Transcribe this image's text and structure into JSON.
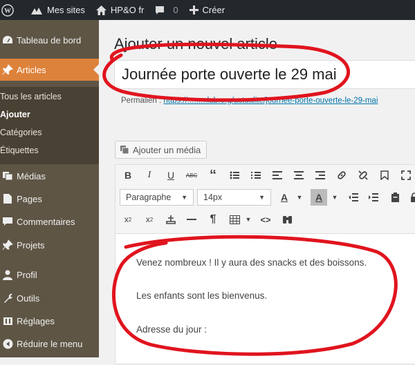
{
  "adminbar": {
    "sites": "Mes sites",
    "site_name": "HP&O fr",
    "comments_count": "0",
    "new": "Créer"
  },
  "sidebar": {
    "items": [
      {
        "label": "Tableau de bord",
        "icon": "dashboard-icon"
      },
      {
        "label": "Articles",
        "icon": "pin-icon",
        "current": true
      },
      {
        "label": "Médias",
        "icon": "media-icon"
      },
      {
        "label": "Pages",
        "icon": "page-icon"
      },
      {
        "label": "Commentaires",
        "icon": "comment-icon"
      },
      {
        "label": "Projets",
        "icon": "pin-icon"
      },
      {
        "label": "Profil",
        "icon": "user-icon"
      },
      {
        "label": "Outils",
        "icon": "wrench-icon"
      },
      {
        "label": "Réglages",
        "icon": "settings-icon"
      },
      {
        "label": "Réduire le menu",
        "icon": "collapse-icon"
      }
    ],
    "submenu": [
      "Tous les articles",
      "Ajouter",
      "Catégories",
      "Étiquettes"
    ]
  },
  "main": {
    "page_title": "Ajouter un nouvel article",
    "post_title": "Journée porte ouverte le 29 mai",
    "permalink_label": "Permalien :",
    "permalink_url": "https://.........lab.org/actualite/journee-porte-ouverte-le-29-mai",
    "add_media": "Ajouter un média"
  },
  "editor": {
    "format_select": "Paragraphe",
    "size_select": "14px",
    "paragraphs": [
      "Venez nombreux ! Il y aura des snacks et des boissons.",
      "Les enfants sont les bienvenus.",
      "Adresse du jour :"
    ]
  },
  "colors": {
    "adminbar": "#23282d",
    "sidebar": "#5e5545",
    "submenu": "#494133",
    "accent": "#dd823b",
    "link": "#0073aa",
    "annotation": "#e0141e"
  }
}
